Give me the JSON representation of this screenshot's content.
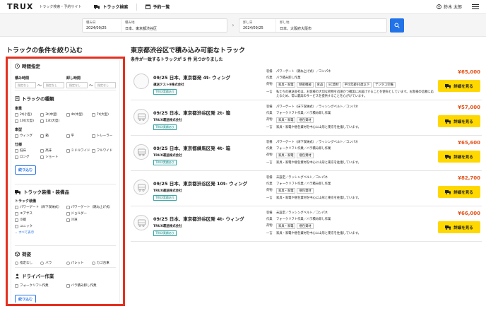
{
  "header": {
    "logo": "TRUX",
    "tagline": "トラック検索・予約サイト",
    "nav": [
      {
        "icon": "truck-icon",
        "label": "トラック検索"
      },
      {
        "icon": "calendar-icon",
        "label": "予約一覧"
      }
    ],
    "user": "鈴木 太郎"
  },
  "search": {
    "load_date_label": "積み日",
    "load_date": "2024/09/25",
    "load_place_label": "積み地",
    "load_place": "日本、東京都渋谷区",
    "unload_date_label": "卸し日",
    "unload_date": "2024/09/25",
    "unload_place_label": "卸し地",
    "unload_place": "日本、大阪府大阪市"
  },
  "sidebar": {
    "title": "トラックの条件を絞り込む",
    "time": {
      "heading": "時間指定",
      "load_label": "積み時間",
      "unload_label": "卸し時間",
      "placeholder": "指定なし",
      "tilde": "〜"
    },
    "type": {
      "heading": "トラックの種類",
      "size_label": "車重",
      "sizes": [
        "2t(小型)",
        "3t(中型)",
        "4t(中型)",
        "7t(大型)",
        "10t(大型)",
        "13t(大型)"
      ],
      "body_label": "車型",
      "bodies": [
        "ウィング",
        "箱",
        "平",
        "トレーラー"
      ],
      "spec_label": "仕様",
      "specs": [
        "低床",
        "高床",
        "ミドルワイド",
        "フルワイド",
        "ロング",
        "ショート"
      ],
      "apply": "絞り込む"
    },
    "equipment": {
      "heading": "トラック装備・装備品",
      "sub": "トラック装備",
      "items": [
        "パワーゲート（床下収納式）",
        "パワーゲート（跳ね上げ式）",
        "エアサス",
        "ジョルダー",
        "冷蔵",
        "冷凍",
        "ユニック"
      ],
      "show_all": "すべて表示"
    },
    "cargo": {
      "heading": "荷姿",
      "items": [
        "指定なし",
        "バラ",
        "パレット",
        "カゴ台車"
      ]
    },
    "driver": {
      "heading": "ドライバー作業",
      "items": [
        "フォークリフト作業",
        "バラ積み卸し作業"
      ],
      "apply": "絞り込む"
    }
  },
  "results": {
    "title": "東京都渋谷区で積み込み可能なトラック",
    "subtitle": "条件が一致するトラックが 5 件 見つかりました",
    "detail_label": "詳細を見る",
    "keys": {
      "equip": "装備",
      "work": "作業",
      "cargo": "荷物",
      "note": "一言"
    },
    "cards": [
      {
        "title": "09/25 日本、東京都発 4t- ウィング",
        "company": "運送テスト9株式会社",
        "badge": "TRUX実績あり",
        "equip": "パワーゲート（跳ね上げ式）／コンパネ",
        "work": "バラ積み卸し作業",
        "cargo": [
          "家具・家電",
          "精密機械",
          "食品",
          "EC資材",
          "平均年齢40歳以下",
          "デジタコ完備"
        ],
        "note": "私たちの運送会社は、お客様の大切な荷物を迅速かつ確実にお届けすることを使命としています。お客様の信頼に応えるため、常に最高のサービスを提供することを心がけています。",
        "price": "¥65,000",
        "has_icon": false
      },
      {
        "title": "09/25 日本、東京都渋谷区発 2t- 箱",
        "company": "TRUX運送株式会社",
        "badge": "TRUX実績あり",
        "equip": "パワーゲート（床下収納式）／ラッシングベルト／コンパネ",
        "work": "フォークリフト作業／バラ積み卸し作業",
        "cargo": [
          "家具・家電",
          "梱包資材"
        ],
        "note": "家具・家電や梱包資材を中心に山形と東京を往復しています。",
        "price": "¥57,000",
        "has_icon": true
      },
      {
        "title": "09/25 日本、東京都練馬区発 4t- 箱",
        "company": "TRUX運送株式会社",
        "badge": "TRUX実績あり",
        "equip": "パワーゲート（床下収納式）／ラッシングベルト／コンパネ",
        "work": "フォークリフト作業／バラ積み卸し作業",
        "cargo": [
          "家具・家電",
          "梱包資材"
        ],
        "note": "家具・家電や梱包資材を中心に山形と東京を往復しています。",
        "price": "¥65,600",
        "has_icon": true
      },
      {
        "title": "09/25 日本、東京都渋谷区発 10t- ウィング",
        "company": "TRUX運送株式会社",
        "badge": "TRUX実績あり",
        "equip": "未設定／ラッシングベルト／コンパネ",
        "work": "フォークリフト作業／バラ積み卸し作業",
        "cargo": [
          "家具・家電",
          "梱包資材"
        ],
        "note": "家具・家電や梱包資材を中心に山形と東京を往復しています。",
        "price": "¥82,700",
        "has_icon": true
      },
      {
        "title": "09/25 日本、東京都渋谷区発 4t- ウィング",
        "company": "TRUX運送株式会社",
        "badge": "TRUX実績あり",
        "equip": "未設定／ラッシングベルト／コンパネ",
        "work": "フォークリフト作業／バラ積み卸し作業",
        "cargo": [
          "家具・家電",
          "梱包資材"
        ],
        "note": "家具・家電や梱包資材を中心に山形と東京を往復しています。",
        "price": "¥66,000",
        "has_icon": true
      }
    ]
  },
  "colors": {
    "accent": "#2272e8",
    "highlight": "#e53020",
    "cta": "#ffd800",
    "price": "#e2541b"
  }
}
